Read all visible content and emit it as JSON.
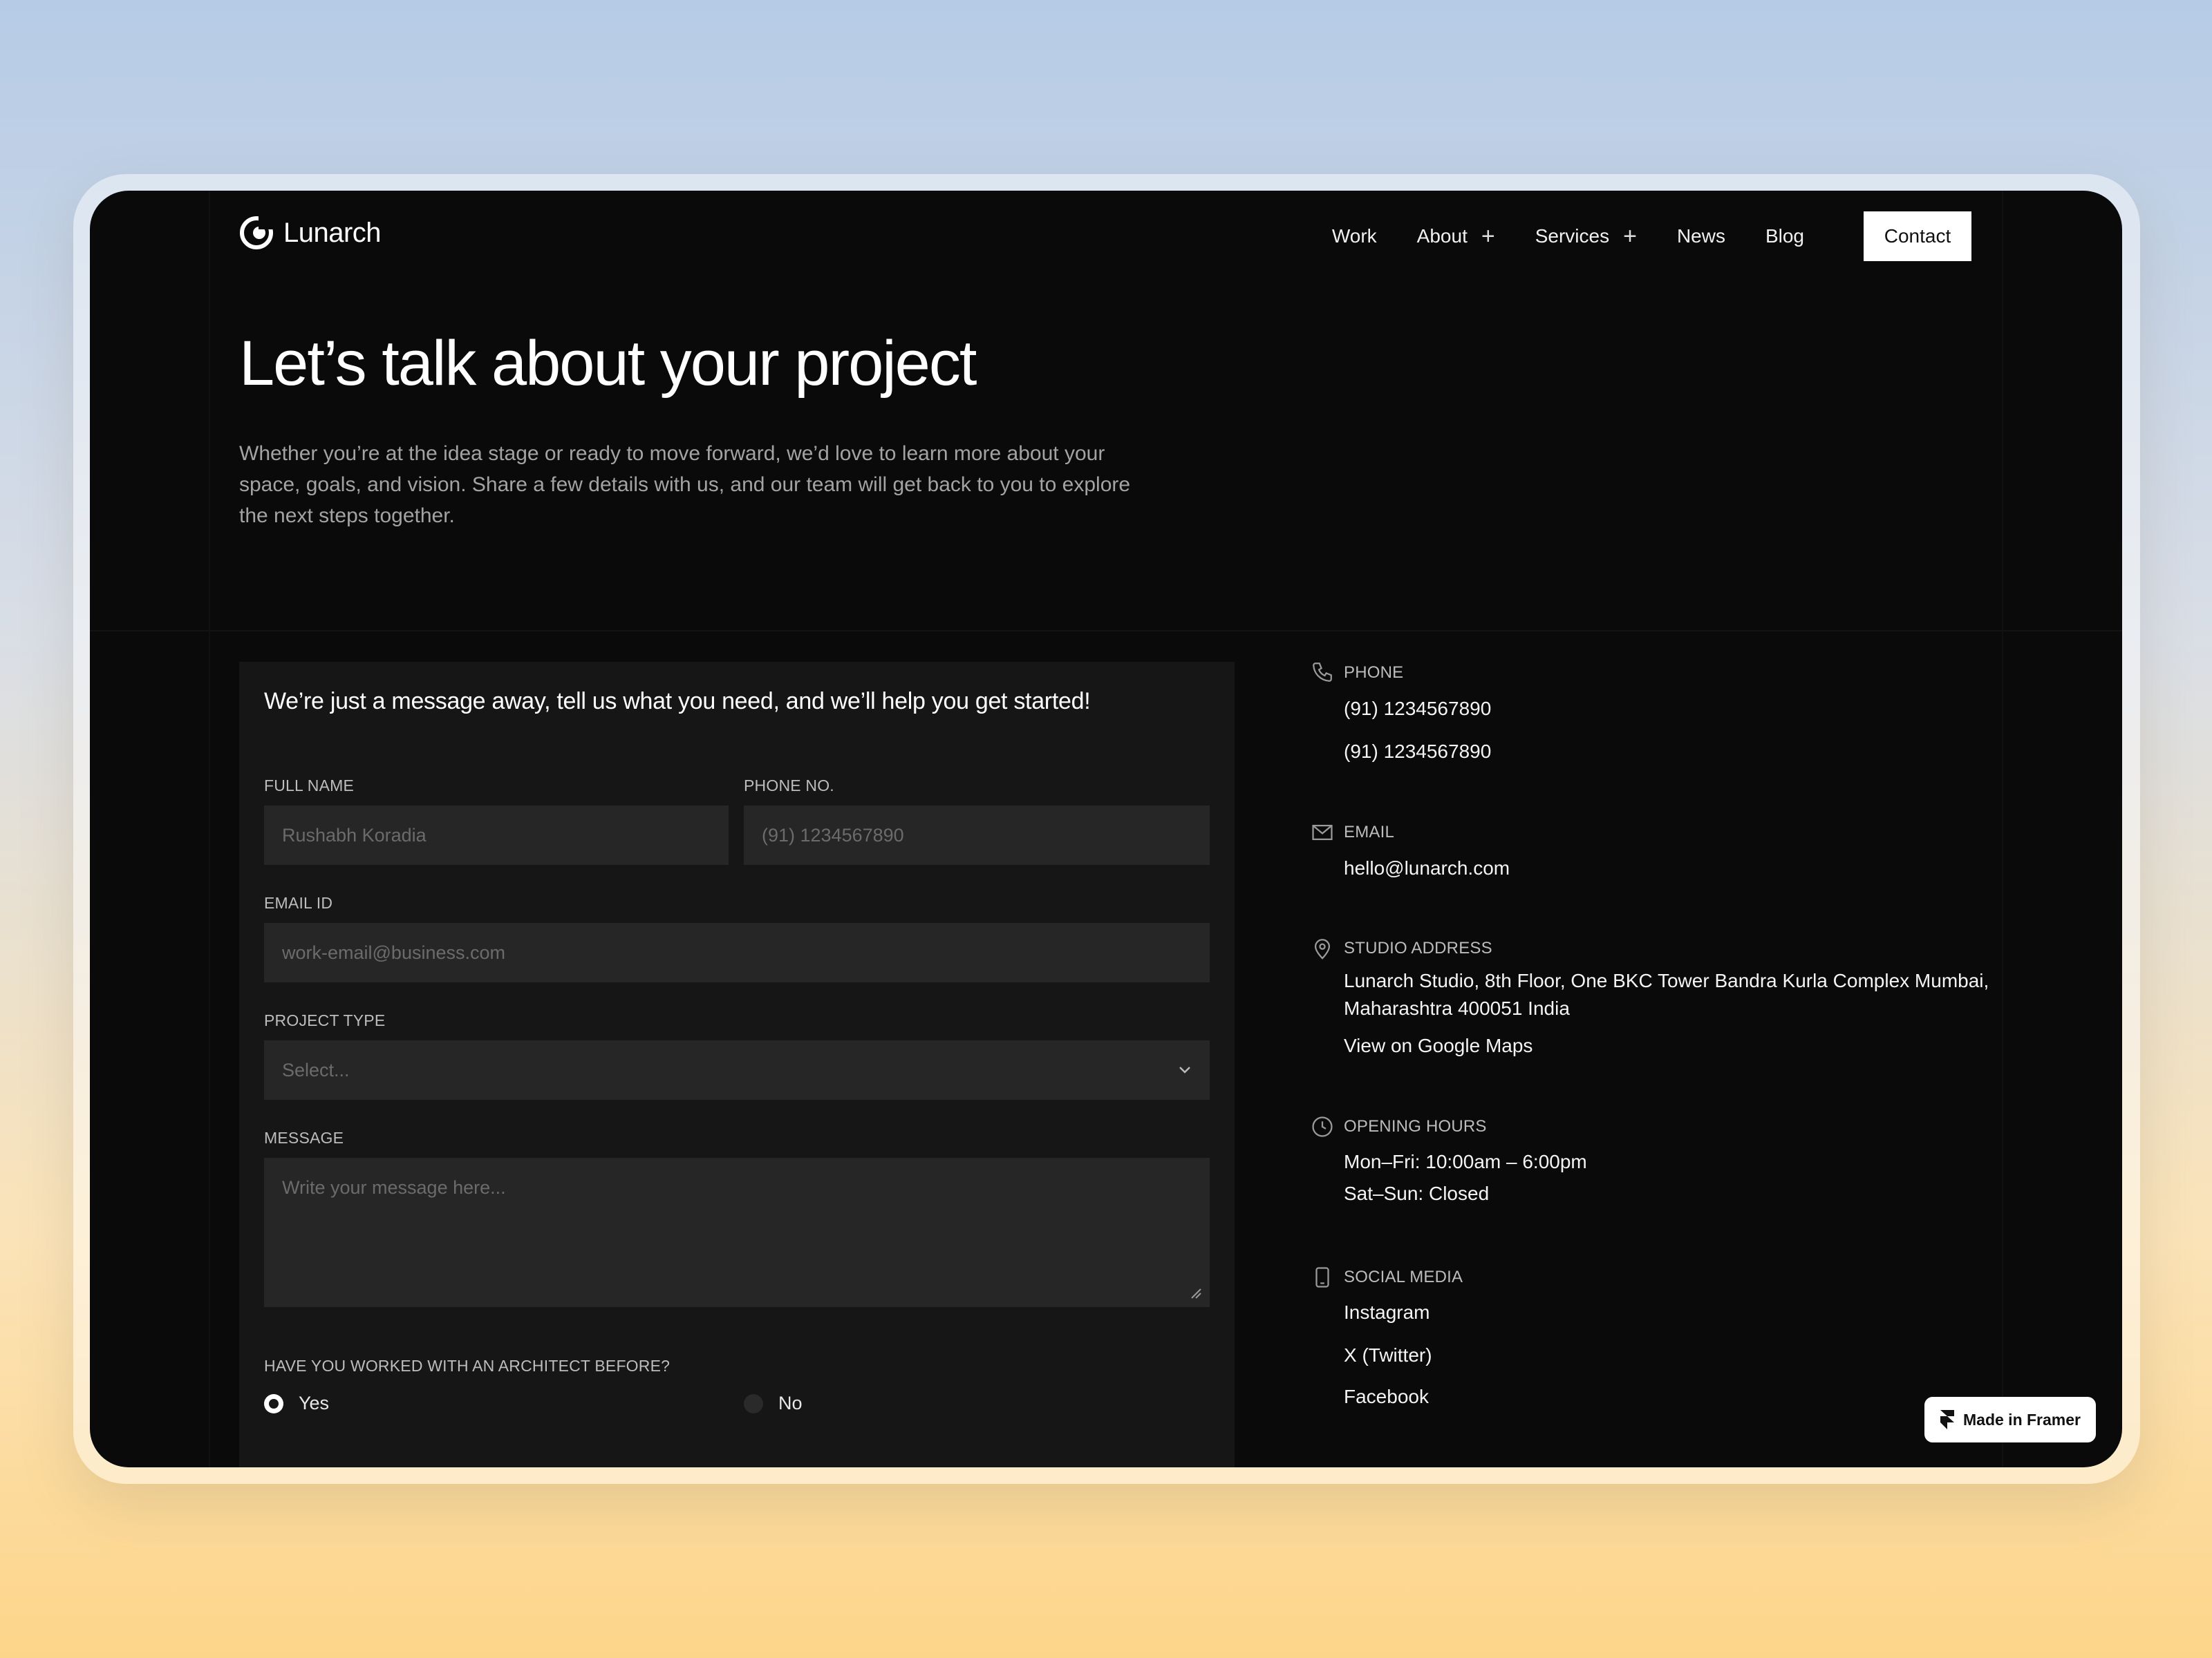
{
  "brand": {
    "name": "Lunarch"
  },
  "nav": {
    "items": [
      {
        "label": "Work",
        "has_submenu": false
      },
      {
        "label": "About",
        "has_submenu": true
      },
      {
        "label": "Services",
        "has_submenu": true
      },
      {
        "label": "News",
        "has_submenu": false
      },
      {
        "label": "Blog",
        "has_submenu": false
      }
    ],
    "cta": "Contact"
  },
  "hero": {
    "title": "Let’s talk about your project",
    "subtitle": "Whether you’re at the idea stage or ready to move forward, we’d love to learn more about your space, goals, and vision. Share a few details with us, and our team will get back to you to explore the next steps together."
  },
  "form": {
    "title": "We’re just a message away, tell us what you need, and we’ll help you get started!",
    "full_name": {
      "label": "FULL NAME",
      "placeholder": "Rushabh Koradia"
    },
    "phone": {
      "label": "PHONE NO.",
      "placeholder": "(91) 1234567890"
    },
    "email": {
      "label": "EMAIL ID",
      "placeholder": "work-email@business.com"
    },
    "project_type": {
      "label": "PROJECT TYPE",
      "placeholder": "Select..."
    },
    "message": {
      "label": "MESSAGE",
      "placeholder": "Write your message here..."
    },
    "architect_question": {
      "label": "HAVE YOU WORKED WITH AN ARCHITECT BEFORE?",
      "options": [
        "Yes",
        "No"
      ],
      "selected": "Yes"
    }
  },
  "info": {
    "phone": {
      "heading": "PHONE",
      "values": [
        "(91) 1234567890",
        "(91) 1234567890"
      ]
    },
    "email": {
      "heading": "EMAIL",
      "value": "hello@lunarch.com"
    },
    "address": {
      "heading": "STUDIO ADDRESS",
      "line1": "Lunarch Studio, 8th Floor, One BKC Tower Bandra Kurla Complex Mumbai,",
      "line2": "Maharashtra 400051 India",
      "map_link": "View on Google Maps"
    },
    "hours": {
      "heading": "OPENING HOURS",
      "weekdays": "Mon–Fri: 10:00am – 6:00pm",
      "weekend": "Sat–Sun: Closed"
    },
    "social": {
      "heading": "SOCIAL MEDIA",
      "links": [
        "Instagram",
        "X (Twitter)",
        "Facebook"
      ]
    }
  },
  "badge": {
    "label": "Made in Framer"
  },
  "colors": {
    "screen_bg": "#0a0a0a",
    "card_bg": "#161616",
    "field_bg": "#262626",
    "accent": "#ffffff"
  }
}
